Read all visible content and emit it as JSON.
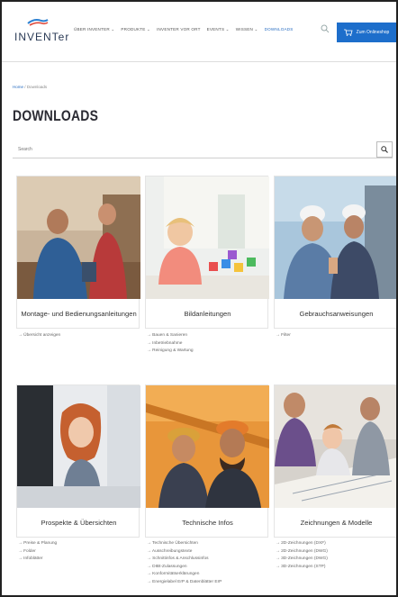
{
  "header": {
    "logo_text": "INVENTer",
    "nav": [
      "ÜBER INVENTER ⌄",
      "PRODUKTE ⌄",
      "INVENTER VOR ORT",
      "EVENTS ⌄",
      "WISSEN ⌄",
      "DOWNLOADS"
    ],
    "cart_label": "Zum Onlineshop"
  },
  "breadcrumb": {
    "home": "Home",
    "sep": "/",
    "current": "Downloads"
  },
  "page_title": "DOWNLOADS",
  "search": {
    "placeholder": "Search",
    "icon": "search-icon"
  },
  "colors": {
    "accent": "#1d6ecb",
    "link": "#2a6ec2",
    "title": "#2b2b33"
  },
  "cards": [
    {
      "title": "Montage- und Bedienungsanleitungen",
      "links": [
        "→ Übersicht anzeigen"
      ]
    },
    {
      "title": "Bildanleitungen",
      "links": [
        "→ Bauen & Sanieren",
        "→ Inbetriebnahme",
        "→ Reinigung & Wartung"
      ]
    },
    {
      "title": "Gebrauchsanweisungen",
      "links": [
        "→ Filter"
      ]
    },
    {
      "title": "Prospekte & Übersichten",
      "links": [
        "→ Preise & Planung",
        "→ Folder",
        "→ Infoblätter"
      ]
    },
    {
      "title": "Technische Infos",
      "links": [
        "→ Technische Übersichten",
        "→ Ausschreibungstexte",
        "→ Schnittinfos & Anschlussinfos",
        "→ DIBt-Zulassungen",
        "→ Konformitätserklärungen",
        "→ Energielabel ErP & Datenblätter ErP"
      ]
    },
    {
      "title": "Zeichnungen & Modelle",
      "links": [
        "→ 2D-Zeichnungen (DXF)",
        "→ 2D-Zeichnungen (DWG)",
        "→ 3D-Zeichnungen (DWG)",
        "→ 3D-Zeichnungen (STP)"
      ]
    }
  ]
}
